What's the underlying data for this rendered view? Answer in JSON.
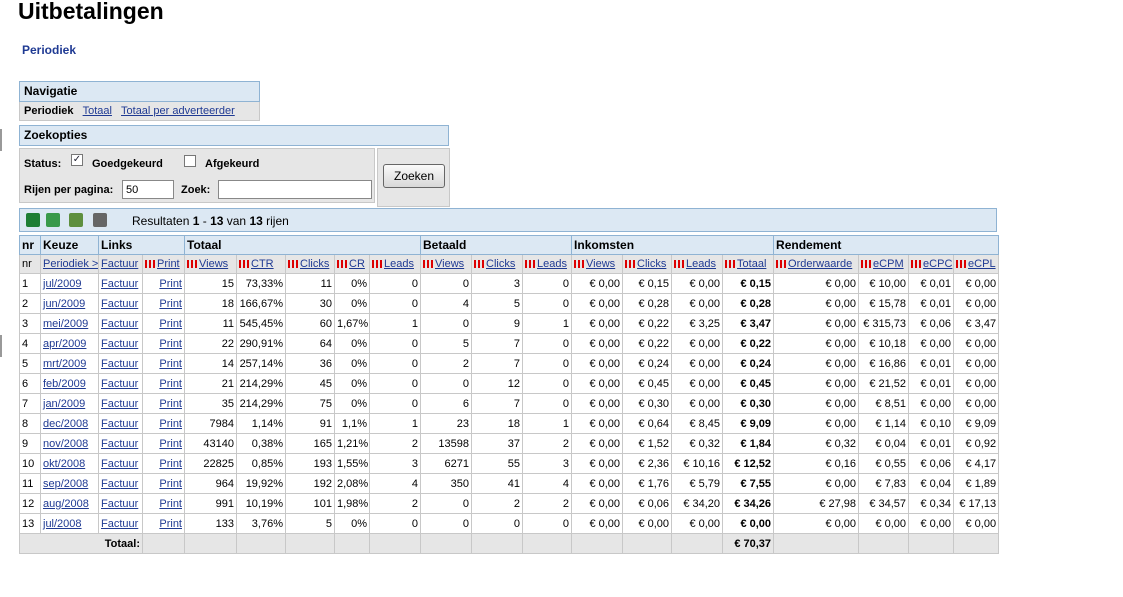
{
  "page": {
    "title": "Uitbetalingen",
    "sublink": "Periodiek"
  },
  "nav": {
    "heading": "Navigatie",
    "current": "Periodiek",
    "links": [
      "Totaal",
      "Totaal per adverteerder"
    ]
  },
  "search": {
    "heading": "Zoekopties",
    "status_label": "Status:",
    "approved_label": "Goedgekeurd",
    "approved_checked": true,
    "rejected_label": "Afgekeurd",
    "rejected_checked": false,
    "rows_label": "Rijen per pagina:",
    "rows_value": "50",
    "search_label": "Zoek:",
    "search_value": "",
    "button": "Zoeken"
  },
  "results": {
    "prefix": "Resultaten ",
    "from": "1",
    "dash": " - ",
    "to": "13",
    "mid": " van ",
    "total": "13",
    "suffix": " rijen",
    "icons": [
      "excel-icon",
      "excel-export-icon",
      "copy-icon",
      "print-icon"
    ]
  },
  "table": {
    "groups": [
      "nr",
      "Keuze",
      "Links",
      "Totaal",
      "Betaald",
      "Inkomsten",
      "Rendement"
    ],
    "subheaders": [
      "nr",
      "Periodiek >",
      "Factuur",
      "Print",
      "Views",
      "CTR",
      "Clicks",
      "CR",
      "Leads",
      "Views",
      "Clicks",
      "Leads",
      "Views",
      "Clicks",
      "Leads",
      "Totaal",
      "Orderwaarde",
      "eCPM",
      "eCPC",
      "eCPL"
    ],
    "rows": [
      [
        "1",
        "jul/2009",
        "Factuur",
        "Print",
        "15",
        "73,33%",
        "11",
        "0%",
        "0",
        "0",
        "3",
        "0",
        "€ 0,00",
        "€ 0,15",
        "€ 0,00",
        "€ 0,15",
        "€ 0,00",
        "€ 10,00",
        "€ 0,01",
        "€ 0,00"
      ],
      [
        "2",
        "jun/2009",
        "Factuur",
        "Print",
        "18",
        "166,67%",
        "30",
        "0%",
        "0",
        "4",
        "5",
        "0",
        "€ 0,00",
        "€ 0,28",
        "€ 0,00",
        "€ 0,28",
        "€ 0,00",
        "€ 15,78",
        "€ 0,01",
        "€ 0,00"
      ],
      [
        "3",
        "mei/2009",
        "Factuur",
        "Print",
        "11",
        "545,45%",
        "60",
        "1,67%",
        "1",
        "0",
        "9",
        "1",
        "€ 0,00",
        "€ 0,22",
        "€ 3,25",
        "€ 3,47",
        "€ 0,00",
        "€ 315,73",
        "€ 0,06",
        "€ 3,47"
      ],
      [
        "4",
        "apr/2009",
        "Factuur",
        "Print",
        "22",
        "290,91%",
        "64",
        "0%",
        "0",
        "5",
        "7",
        "0",
        "€ 0,00",
        "€ 0,22",
        "€ 0,00",
        "€ 0,22",
        "€ 0,00",
        "€ 10,18",
        "€ 0,00",
        "€ 0,00"
      ],
      [
        "5",
        "mrt/2009",
        "Factuur",
        "Print",
        "14",
        "257,14%",
        "36",
        "0%",
        "0",
        "2",
        "7",
        "0",
        "€ 0,00",
        "€ 0,24",
        "€ 0,00",
        "€ 0,24",
        "€ 0,00",
        "€ 16,86",
        "€ 0,01",
        "€ 0,00"
      ],
      [
        "6",
        "feb/2009",
        "Factuur",
        "Print",
        "21",
        "214,29%",
        "45",
        "0%",
        "0",
        "0",
        "12",
        "0",
        "€ 0,00",
        "€ 0,45",
        "€ 0,00",
        "€ 0,45",
        "€ 0,00",
        "€ 21,52",
        "€ 0,01",
        "€ 0,00"
      ],
      [
        "7",
        "jan/2009",
        "Factuur",
        "Print",
        "35",
        "214,29%",
        "75",
        "0%",
        "0",
        "6",
        "7",
        "0",
        "€ 0,00",
        "€ 0,30",
        "€ 0,00",
        "€ 0,30",
        "€ 0,00",
        "€ 8,51",
        "€ 0,00",
        "€ 0,00"
      ],
      [
        "8",
        "dec/2008",
        "Factuur",
        "Print",
        "7984",
        "1,14%",
        "91",
        "1,1%",
        "1",
        "23",
        "18",
        "1",
        "€ 0,00",
        "€ 0,64",
        "€ 8,45",
        "€ 9,09",
        "€ 0,00",
        "€ 1,14",
        "€ 0,10",
        "€ 9,09"
      ],
      [
        "9",
        "nov/2008",
        "Factuur",
        "Print",
        "43140",
        "0,38%",
        "165",
        "1,21%",
        "2",
        "13598",
        "37",
        "2",
        "€ 0,00",
        "€ 1,52",
        "€ 0,32",
        "€ 1,84",
        "€ 0,32",
        "€ 0,04",
        "€ 0,01",
        "€ 0,92"
      ],
      [
        "10",
        "okt/2008",
        "Factuur",
        "Print",
        "22825",
        "0,85%",
        "193",
        "1,55%",
        "3",
        "6271",
        "55",
        "3",
        "€ 0,00",
        "€ 2,36",
        "€ 10,16",
        "€ 12,52",
        "€ 0,16",
        "€ 0,55",
        "€ 0,06",
        "€ 4,17"
      ],
      [
        "11",
        "sep/2008",
        "Factuur",
        "Print",
        "964",
        "19,92%",
        "192",
        "2,08%",
        "4",
        "350",
        "41",
        "4",
        "€ 0,00",
        "€ 1,76",
        "€ 5,79",
        "€ 7,55",
        "€ 0,00",
        "€ 7,83",
        "€ 0,04",
        "€ 1,89"
      ],
      [
        "12",
        "aug/2008",
        "Factuur",
        "Print",
        "991",
        "10,19%",
        "101",
        "1,98%",
        "2",
        "0",
        "2",
        "2",
        "€ 0,00",
        "€ 0,06",
        "€ 34,20",
        "€ 34,26",
        "€ 27,98",
        "€ 34,57",
        "€ 0,34",
        "€ 17,13"
      ],
      [
        "13",
        "jul/2008",
        "Factuur",
        "Print",
        "133",
        "3,76%",
        "5",
        "0%",
        "0",
        "0",
        "0",
        "0",
        "€ 0,00",
        "€ 0,00",
        "€ 0,00",
        "€ 0,00",
        "€ 0,00",
        "€ 0,00",
        "€ 0,00",
        "€ 0,00"
      ]
    ],
    "total_label": "Totaal:",
    "total_value": "€ 70,37"
  }
}
